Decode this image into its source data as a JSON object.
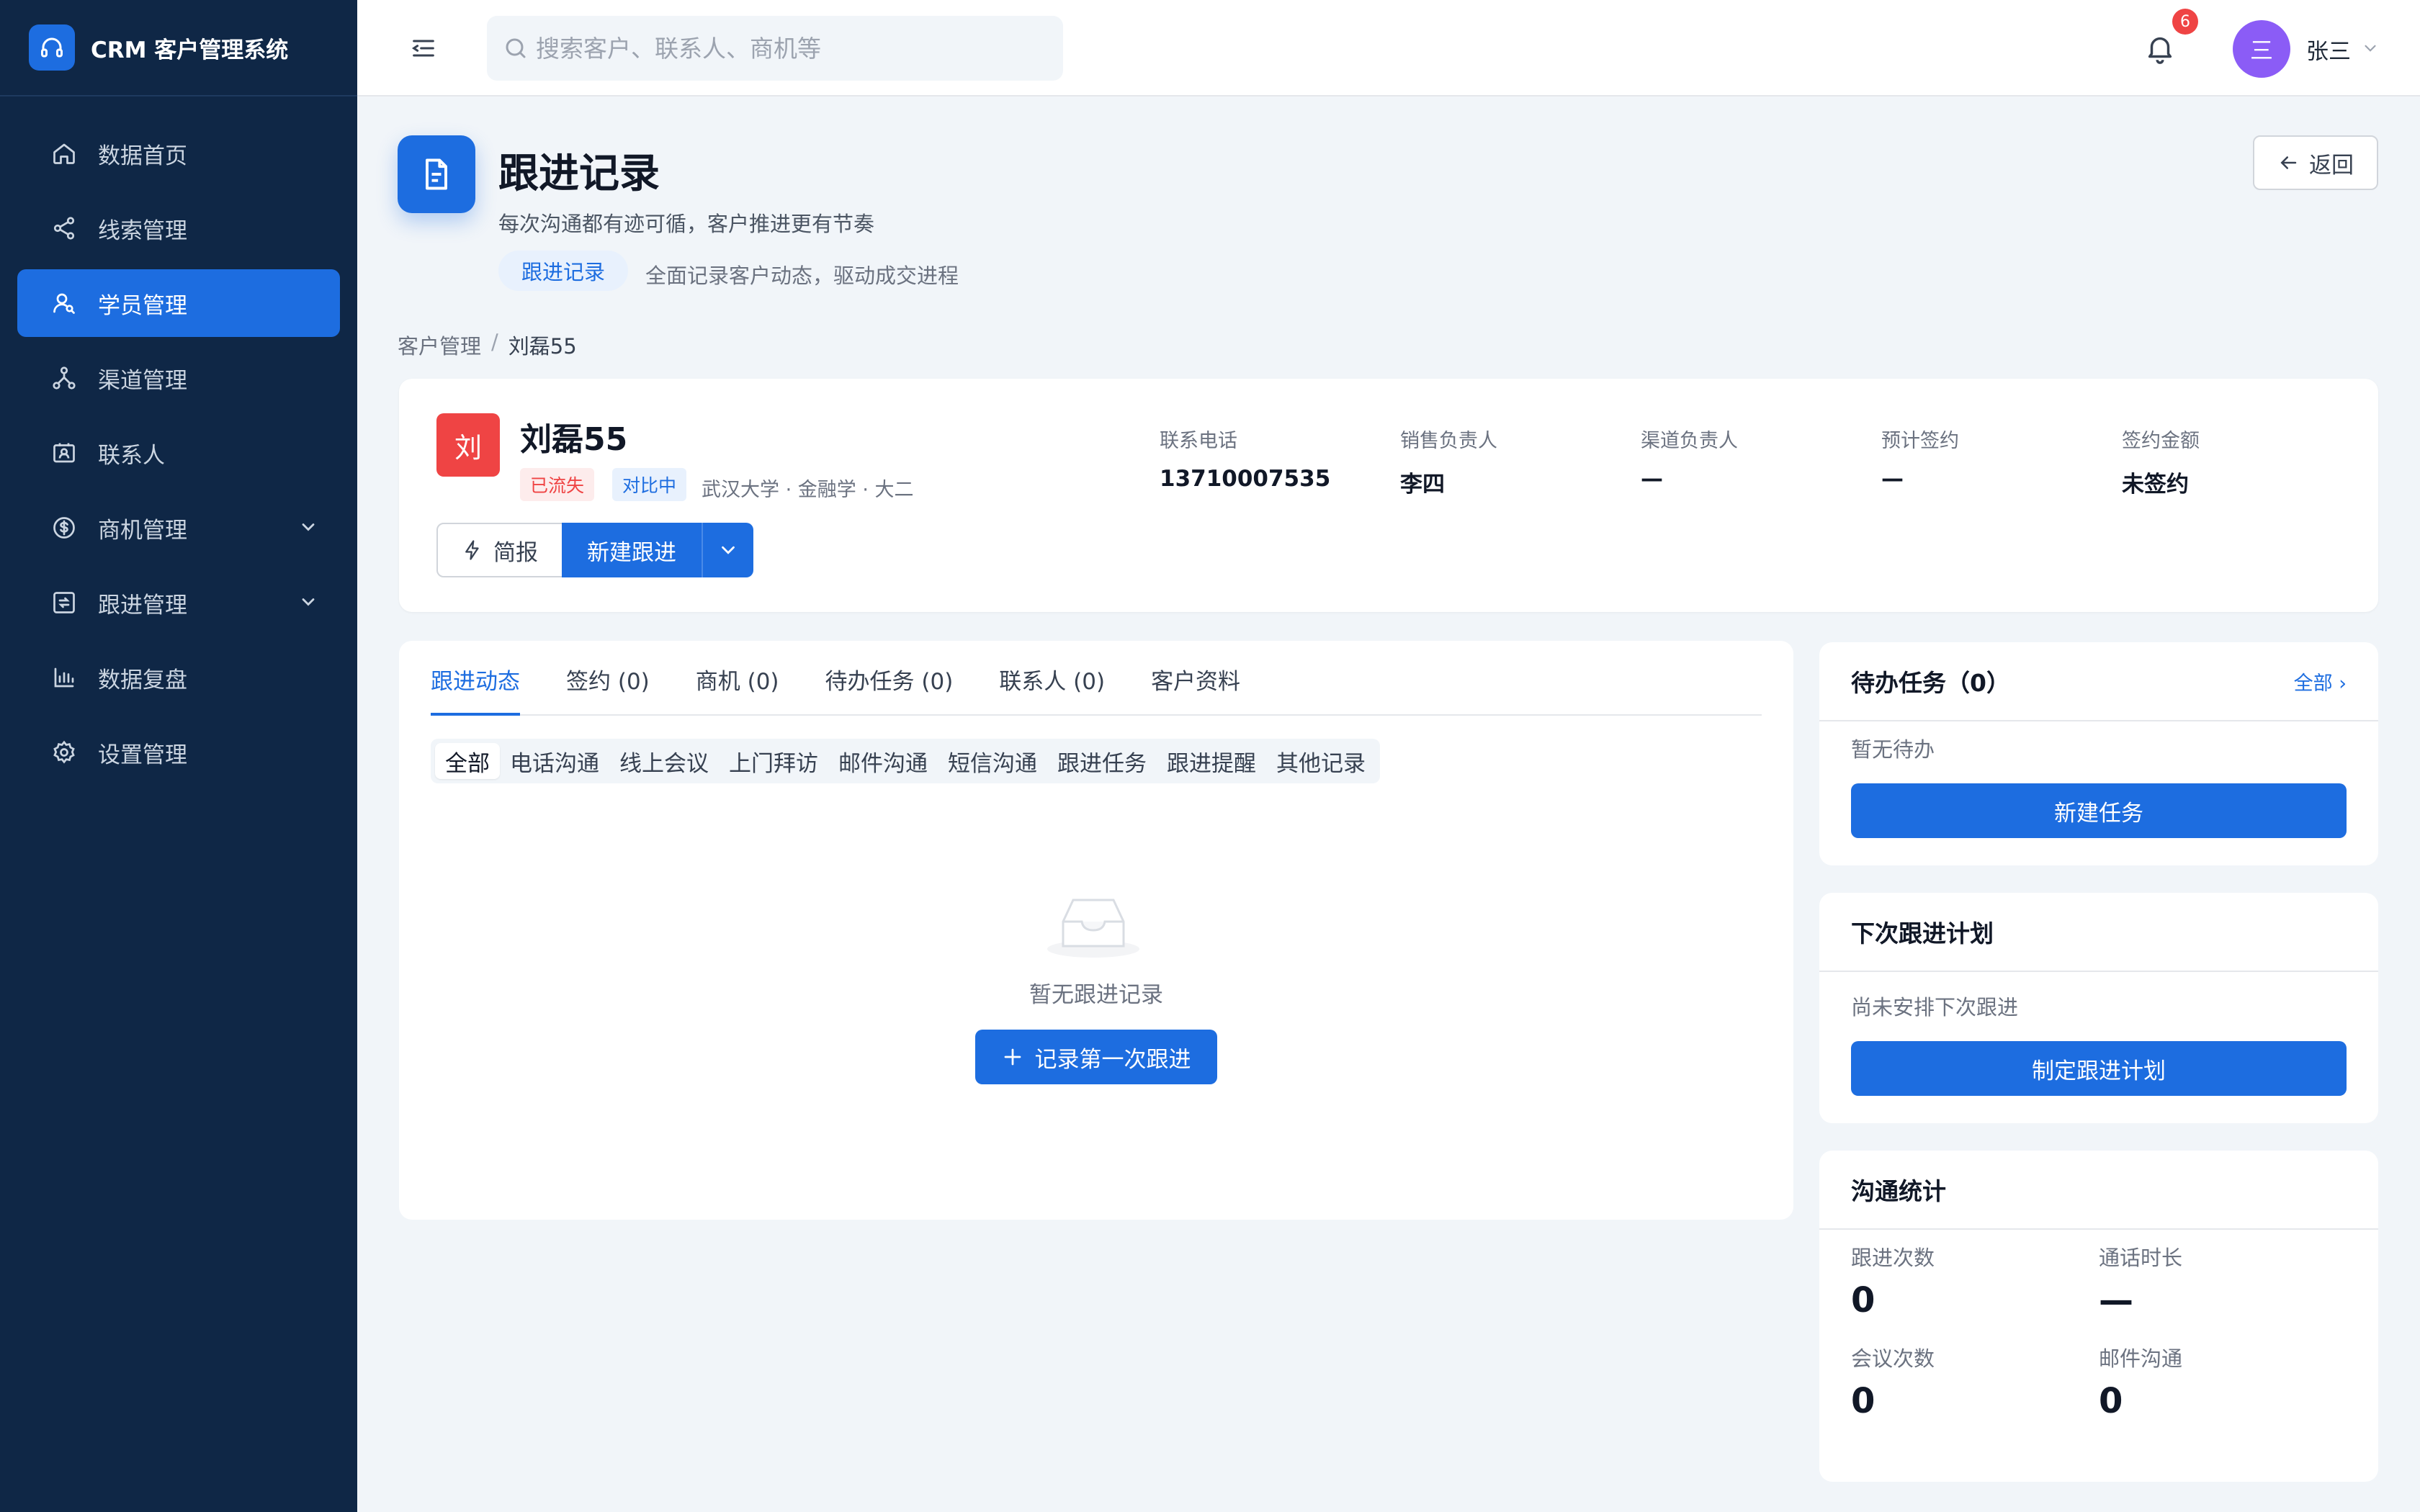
{
  "brand": {
    "title": "CRM 客户管理系统"
  },
  "sidebar": {
    "items": [
      {
        "label": "数据首页"
      },
      {
        "label": "线索管理"
      },
      {
        "label": "学员管理"
      },
      {
        "label": "渠道管理"
      },
      {
        "label": "联系人"
      },
      {
        "label": "商机管理"
      },
      {
        "label": "跟进管理"
      },
      {
        "label": "数据复盘"
      },
      {
        "label": "设置管理"
      }
    ],
    "active_index": 2
  },
  "header": {
    "search_placeholder": "搜索客户、联系人、商机等",
    "notification_count": "6",
    "user_avatar": "三",
    "user_name": "张三"
  },
  "page": {
    "title": "跟进记录",
    "subtitle": "每次沟通都有迹可循，客户推进更有节奏",
    "chip": "跟进记录",
    "chip_desc": "全面记录客户动态，驱动成交进程",
    "back_label": "返回"
  },
  "breadcrumb": {
    "parent": "客户管理",
    "separator": "/",
    "current": "刘磊55"
  },
  "customer": {
    "avatar": "刘",
    "name": "刘磊55",
    "tag_status": "已流失",
    "tag_type": "对比中",
    "school": "武汉大学 · 金融学 · 大二",
    "brief_label": "简报",
    "new_label": "新建跟进",
    "info": [
      {
        "label": "联系电话",
        "value": "13710007535"
      },
      {
        "label": "销售负责人",
        "value": "李四"
      },
      {
        "label": "渠道负责人",
        "value": "—"
      },
      {
        "label": "预计签约",
        "value": "—"
      },
      {
        "label": "签约金额",
        "value": "未签约"
      }
    ]
  },
  "main": {
    "tabs": [
      {
        "label": "跟进动态"
      },
      {
        "label": "签约 (0)"
      },
      {
        "label": "商机 (0)"
      },
      {
        "label": "待办任务 (0)"
      },
      {
        "label": "联系人 (0)"
      },
      {
        "label": "客户资料"
      }
    ],
    "filters": [
      "全部",
      "电话沟通",
      "线上会议",
      "上门拜访",
      "邮件沟通",
      "短信沟通",
      "跟进任务",
      "跟进提醒",
      "其他记录"
    ],
    "empty_text": "暂无跟进记录",
    "empty_button": "记录第一次跟进"
  },
  "todo": {
    "title": "待办任务（0）",
    "link": "全部 ›",
    "empty": "暂无待办",
    "button": "新建任务"
  },
  "next_plan": {
    "title": "下次跟进计划",
    "empty": "尚未安排下次跟进",
    "button": "制定跟进计划"
  },
  "stats": {
    "title": "沟通统计",
    "items": [
      {
        "label": "跟进次数",
        "value": "0"
      },
      {
        "label": "通话时长",
        "value": "—"
      },
      {
        "label": "会议次数",
        "value": "0"
      },
      {
        "label": "邮件沟通",
        "value": "0"
      }
    ]
  },
  "colors": {
    "sidebar_bg": "#0f2746",
    "primary": "#1d6de0",
    "danger": "#ef4444",
    "avatar_purple": "#8b5cf6"
  }
}
